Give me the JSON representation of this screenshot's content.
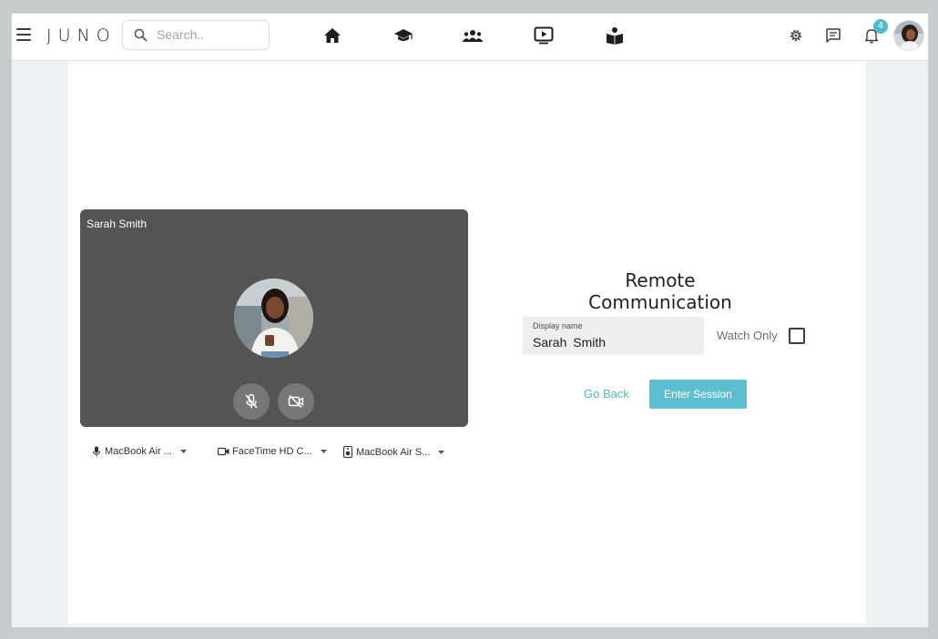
{
  "app": {
    "logo": "JUNO"
  },
  "search": {
    "placeholder": "Search.."
  },
  "nav": {
    "items": [
      {
        "icon": "home-icon"
      },
      {
        "icon": "graduation-cap-icon"
      },
      {
        "icon": "people-group-icon"
      },
      {
        "icon": "video-play-icon"
      },
      {
        "icon": "reading-icon"
      }
    ]
  },
  "header_right": {
    "settings_icon": "gear-icon",
    "chat_icon": "message-icon",
    "notifications_icon": "bell-icon",
    "notification_count": "4"
  },
  "video": {
    "participant_name": "Sarah Smith"
  },
  "devices": {
    "microphone": "MacBook Air ...",
    "camera": "FaceTime HD C...",
    "speaker": "MacBook Air S..."
  },
  "session": {
    "title": "Remote Communication",
    "display_name_label": "Display name",
    "display_name_value": "Sarah Smith",
    "watch_only_label": "Watch Only",
    "watch_only_checked": false,
    "go_back_label": "Go Back",
    "enter_label": "Enter Session"
  },
  "colors": {
    "accent": "#5bbfcf",
    "video_bg": "#545454",
    "control_bg": "#777777"
  }
}
